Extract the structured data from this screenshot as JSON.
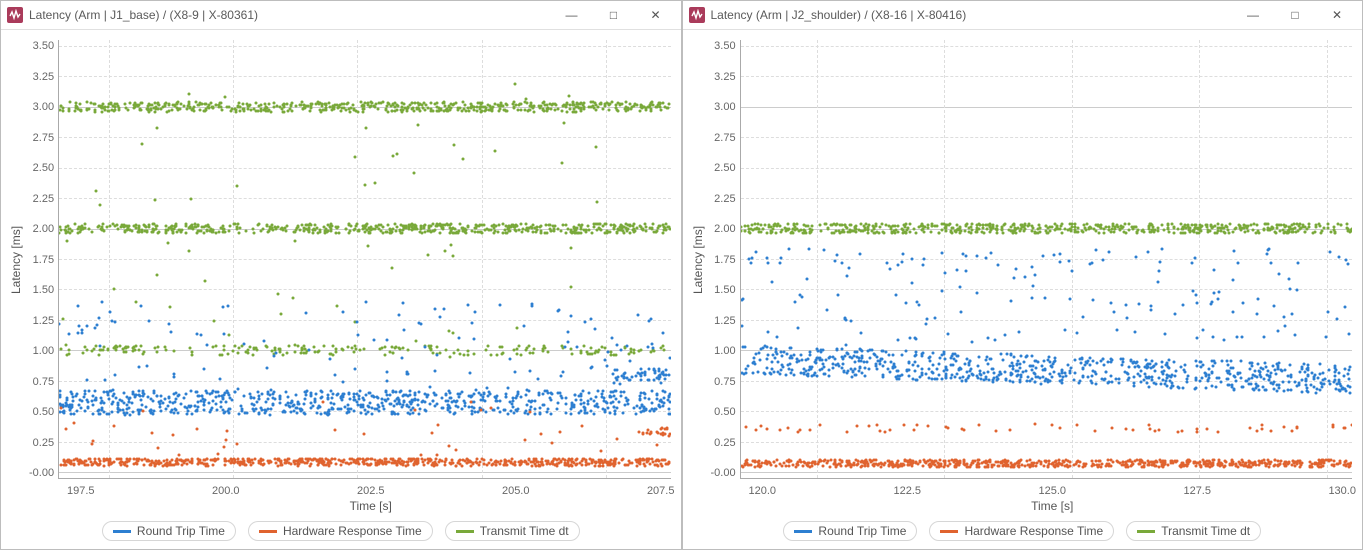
{
  "windows": [
    {
      "title": "Latency (Arm | J1_base) / (X8-9 | X-80361)",
      "ylabel": "Latency [ms]",
      "xlabel": "Time [s]",
      "yticks": [
        "3.50",
        "3.25",
        "3.00",
        "2.75",
        "2.50",
        "2.25",
        "2.00",
        "1.75",
        "1.50",
        "1.25",
        "1.00",
        "0.75",
        "0.50",
        "0.25",
        "-0.00"
      ],
      "xticks": [
        "197.5",
        "200.0",
        "202.5",
        "205.0",
        "207.5"
      ],
      "xlim": [
        196.5,
        208.8
      ],
      "ylim": [
        -0.05,
        3.55
      ],
      "legend": [
        {
          "label": "Round Trip Time",
          "color": "#2d7fd1"
        },
        {
          "label": "Hardware Response Time",
          "color": "#e0632f"
        },
        {
          "label": "Transmit Time dt",
          "color": "#79a93a"
        }
      ],
      "series_desc": {
        "round_trip": {
          "color": "#2d7fd1",
          "band_center": 0.57,
          "band_spread": 0.1,
          "outlier_max": 1.4
        },
        "hw_response": {
          "color": "#e0632f",
          "band_center": 0.08,
          "band_spread": 0.03,
          "outlier_max": 0.6
        },
        "transmit_dt": {
          "color": "#79a93a",
          "bands": [
            1.0,
            2.0,
            3.0
          ],
          "band_spread": 0.04
        }
      }
    },
    {
      "title": "Latency (Arm | J2_shoulder) / (X8-16 | X-80416)",
      "ylabel": "Latency [ms]",
      "xlabel": "Time [s]",
      "yticks": [
        "3.50",
        "3.25",
        "3.00",
        "2.75",
        "2.50",
        "2.25",
        "2.00",
        "1.75",
        "1.50",
        "1.25",
        "1.00",
        "0.75",
        "0.50",
        "0.25",
        "-0.00"
      ],
      "xticks": [
        "120.0",
        "122.5",
        "125.0",
        "127.5",
        "130.0"
      ],
      "xlim": [
        118.5,
        130.5
      ],
      "ylim": [
        -0.05,
        3.55
      ],
      "legend": [
        {
          "label": "Round Trip Time",
          "color": "#2d7fd1"
        },
        {
          "label": "Hardware Response Time",
          "color": "#e0632f"
        },
        {
          "label": "Transmit Time dt",
          "color": "#79a93a"
        }
      ],
      "series_desc": {
        "round_trip": {
          "color": "#2d7fd1",
          "band_center": 0.92,
          "band_spread": 0.12,
          "secondary_center": 1.77,
          "secondary_spread": 0.07,
          "secondary_density": 0.08
        },
        "hw_response": {
          "color": "#e0632f",
          "band_center": 0.07,
          "band_spread": 0.03,
          "secondary_center": 0.36,
          "secondary_spread": 0.03,
          "secondary_density": 0.1
        },
        "transmit_dt": {
          "color": "#79a93a",
          "bands": [
            2.0
          ],
          "band_spread": 0.04
        }
      }
    }
  ],
  "win_controls": {
    "minimize": "—",
    "maximize": "□",
    "close": "✕"
  },
  "chart_data": [
    {
      "type": "scatter",
      "title": "Latency (Arm | J1_base) / (X8-9 | X-80361)",
      "xlabel": "Time [s]",
      "ylabel": "Latency [ms]",
      "xlim": [
        196.5,
        208.8
      ],
      "ylim": [
        -0.05,
        3.55
      ],
      "x_ticks": [
        197.5,
        200.0,
        202.5,
        205.0,
        207.5
      ],
      "y_ticks": [
        -0.0,
        0.25,
        0.5,
        0.75,
        1.0,
        1.25,
        1.5,
        1.75,
        2.0,
        2.25,
        2.5,
        2.75,
        3.0,
        3.25,
        3.5
      ],
      "grid": "dashed",
      "legend_position": "bottom-center",
      "series": [
        {
          "name": "Round Trip Time",
          "color": "#2d7fd1",
          "description": "Dense horizontal band of points around y≈0.55–0.60 ms across x≈196.5–208.8 s, with scattered outliers up to ~1.4 ms and a denser cluster near 0.80 ms around x≈207.5–208.8 s.",
          "approx_band": {
            "y_center": 0.57,
            "y_spread": 0.1,
            "x_range": [
              196.5,
              208.8
            ]
          },
          "outliers_y_range": [
            0.65,
            1.4
          ]
        },
        {
          "name": "Hardware Response Time",
          "color": "#e0632f",
          "description": "Dense band near y≈0.05–0.10 ms across full x range; occasional outliers up to ~0.5 ms and a cluster near 0.35 ms at x≈208.5 s.",
          "approx_band": {
            "y_center": 0.08,
            "y_spread": 0.03,
            "x_range": [
              196.5,
              208.8
            ]
          },
          "outliers_y_range": [
            0.1,
            0.55
          ]
        },
        {
          "name": "Transmit Time dt",
          "color": "#79a93a",
          "description": "Three discrete horizontal bands of points at y≈1.0, 2.0, and 3.0 ms across full x range, each with small ±0.05 ms jitter; the 1.0 ms band is sparsest, with occasional stray points between bands.",
          "bands_y": [
            1.0,
            2.0,
            3.0
          ],
          "band_spread": 0.05,
          "x_range": [
            196.5,
            208.8
          ]
        }
      ]
    },
    {
      "type": "scatter",
      "title": "Latency (Arm | J2_shoulder) / (X8-16 | X-80416)",
      "xlabel": "Time [s]",
      "ylabel": "Latency [ms]",
      "xlim": [
        118.5,
        130.5
      ],
      "ylim": [
        -0.05,
        3.55
      ],
      "x_ticks": [
        120.0,
        122.5,
        125.0,
        127.5,
        130.0
      ],
      "y_ticks": [
        -0.0,
        0.25,
        0.5,
        0.75,
        1.0,
        1.25,
        1.5,
        1.75,
        2.0,
        2.25,
        2.5,
        2.75,
        3.0,
        3.25,
        3.5
      ],
      "grid": "dashed",
      "legend_position": "bottom-center",
      "series": [
        {
          "name": "Round Trip Time",
          "color": "#2d7fd1",
          "description": "Main dense band drifting slightly downward from y≈0.98 ms at x≈118.5 s to y≈0.82 ms at x≈130.5 s, with a sparse secondary band of points near y≈1.75–1.80 ms across full x range and occasional outliers up to 1.4 ms.",
          "approx_band": {
            "y_center": 0.9,
            "y_spread": 0.12,
            "x_range": [
              118.5,
              130.5
            ]
          },
          "secondary_band": {
            "y_center": 1.77,
            "y_spread": 0.07
          }
        },
        {
          "name": "Hardware Response Time",
          "color": "#e0632f",
          "description": "Dense band near y≈0.05–0.10 ms across full x range, plus a sparse secondary band near y≈0.35 ms.",
          "approx_band": {
            "y_center": 0.07,
            "y_spread": 0.03,
            "x_range": [
              118.5,
              130.5
            ]
          },
          "secondary_band": {
            "y_center": 0.36,
            "y_spread": 0.03
          }
        },
        {
          "name": "Transmit Time dt",
          "color": "#79a93a",
          "description": "Single dense horizontal band at y≈2.0 ms (±0.05 ms jitter) across full x range.",
          "bands_y": [
            2.0
          ],
          "band_spread": 0.05,
          "x_range": [
            118.5,
            130.5
          ]
        }
      ]
    }
  ]
}
